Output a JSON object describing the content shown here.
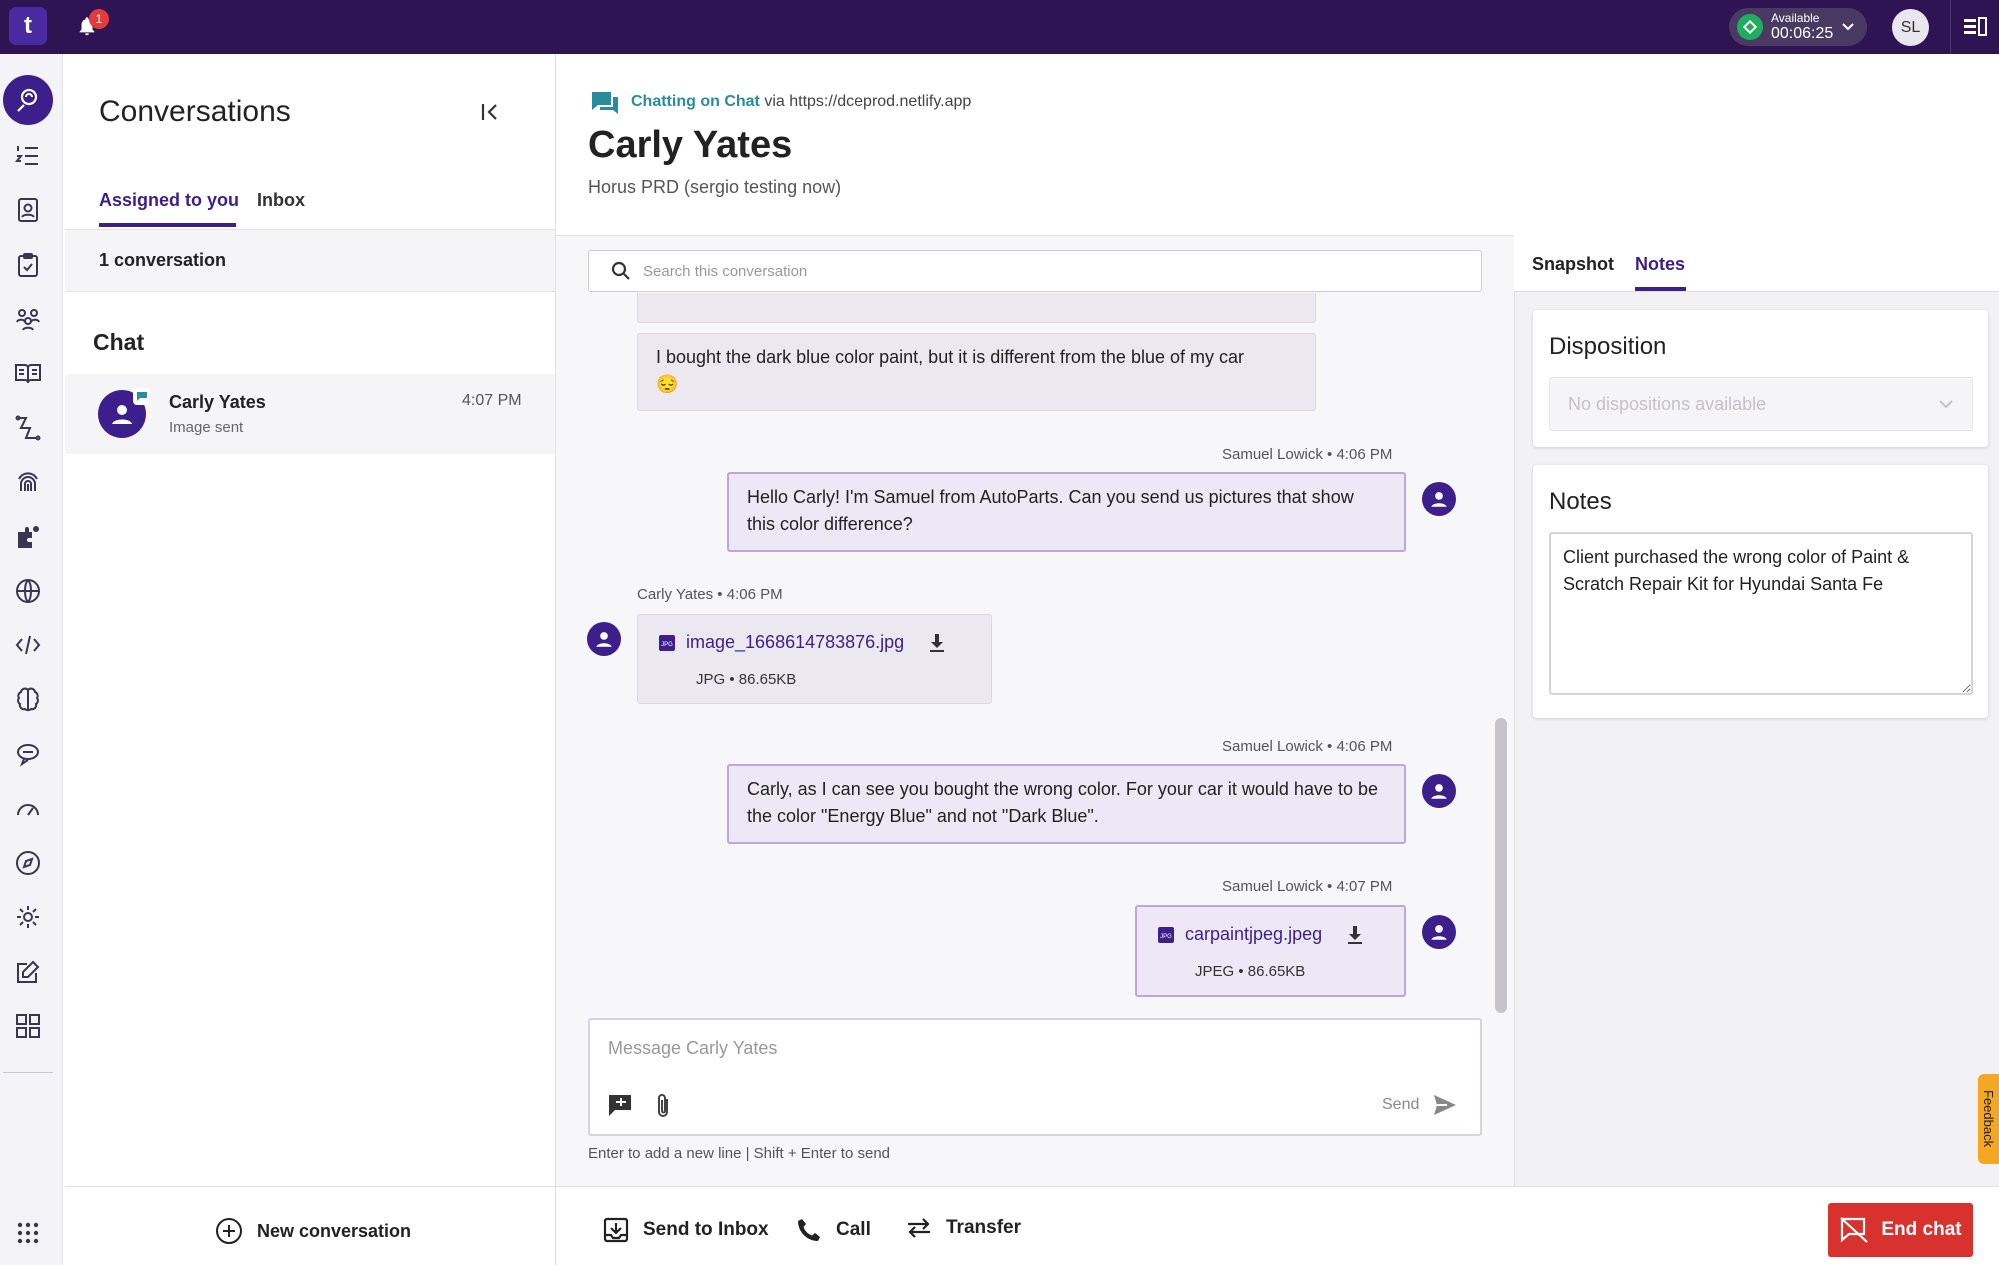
{
  "topbar": {
    "logo": "t",
    "notification_count": "1",
    "status_label": "Available",
    "status_timer": "00:06:25",
    "user_initials": "SL"
  },
  "rail": {
    "icons": [
      "agent-home-icon",
      "queue-list-icon",
      "contacts-icon",
      "tasks-icon",
      "teams-icon",
      "knowledge-icon",
      "flows-icon",
      "fingerprint-icon",
      "integrations-icon",
      "globe-icon",
      "code-icon",
      "brain-icon",
      "chat-bubble-icon",
      "dashboard-icon",
      "compass-icon",
      "settings-icon",
      "edit-icon",
      "apps-grid-icon"
    ]
  },
  "conversations": {
    "title": "Conversations",
    "tabs": [
      "Assigned to you",
      "Inbox"
    ],
    "count": "1 conversation",
    "section": "Chat",
    "items": [
      {
        "name": "Carly Yates",
        "subtitle": "Image sent",
        "time": "4:07 PM"
      }
    ],
    "new_conversation": "New conversation"
  },
  "header": {
    "channel": "Chatting on Chat",
    "via": "via https://dceprod.netlify.app",
    "customer_name": "Carly Yates",
    "subtitle": "Horus PRD (sergio testing now)"
  },
  "search": {
    "placeholder": "Search this conversation"
  },
  "messages": [
    {
      "type": "text",
      "direction": "in",
      "text": "I bought the dark blue color paint, but it is different from the blue of my car",
      "emoji": "😔"
    },
    {
      "type": "text",
      "direction": "out",
      "meta": "Samuel Lowick • 4:06 PM",
      "text": "Hello Carly! I'm Samuel from AutoParts. Can you send us pictures that show this color difference?"
    },
    {
      "type": "file",
      "direction": "in",
      "meta": "Carly Yates • 4:06 PM",
      "file_name": "image_1668614783876.jpg",
      "file_meta": "JPG • 86.65KB"
    },
    {
      "type": "text",
      "direction": "out",
      "meta": "Samuel Lowick • 4:06 PM",
      "text": "Carly, as I can see you bought the wrong color. For your car it would have to be the color \"Energy Blue\" and not \"Dark Blue\"."
    },
    {
      "type": "file",
      "direction": "out",
      "meta": "Samuel Lowick • 4:07 PM",
      "file_name": "carpaintjpeg.jpeg",
      "file_meta": "JPEG • 86.65KB"
    }
  ],
  "composer": {
    "placeholder": "Message Carly Yates",
    "send_label": "Send",
    "hint": "Enter to add a new line | Shift + Enter to send"
  },
  "actions": {
    "send_to_inbox": "Send to Inbox",
    "call": "Call",
    "transfer": "Transfer",
    "end_chat": "End chat"
  },
  "right_panel": {
    "tabs": [
      "Snapshot",
      "Notes"
    ],
    "active_tab": "Notes",
    "disposition_title": "Disposition",
    "disposition_placeholder": "No dispositions available",
    "notes_title": "Notes",
    "notes_value": "Client purchased the wrong color of Paint & Scratch Repair Kit for Hyundai Santa Fe"
  },
  "feedback_label": "Feedback",
  "colors": {
    "topbar": "#2e1452",
    "accent": "#3d1f8c",
    "channel": "#2a8c9a",
    "status_green": "#1fae5e",
    "end_chat": "#d7322e",
    "feedback": "#f5a623"
  }
}
